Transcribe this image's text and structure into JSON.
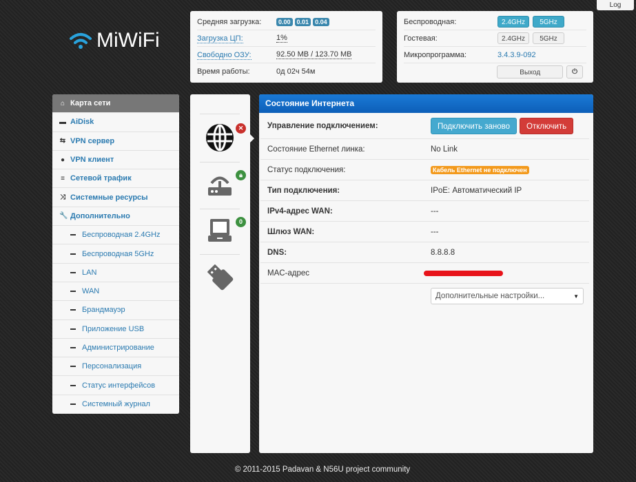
{
  "logo": "MiWiFi",
  "log_button": "Log",
  "status": {
    "avg_load_label": "Средняя загрузка:",
    "avg_load": [
      "0.00",
      "0.01",
      "0.04"
    ],
    "cpu_label": "Загрузка ЦП:",
    "cpu": "1%",
    "ram_label": "Свободно ОЗУ:",
    "ram": "92.50 MB / 123.70 MB",
    "uptime_label": "Время работы:",
    "uptime": "0д 02ч 54м"
  },
  "wireless": {
    "wireless_label": "Беспроводная:",
    "guest_label": "Гостевая:",
    "band24": "2.4GHz",
    "band5": "5GHz",
    "firmware_label": "Микропрограмма:",
    "firmware": "3.4.3.9-092",
    "logout": "Выход"
  },
  "sidebar": {
    "items": [
      {
        "label": "Карта сети",
        "icon": "home-icon",
        "glyph": "⌂"
      },
      {
        "label": "AiDisk",
        "icon": "hdd-icon",
        "glyph": "▬"
      },
      {
        "label": "VPN сервер",
        "icon": "retweet-icon",
        "glyph": "⇆"
      },
      {
        "label": "VPN клиент",
        "icon": "globe-icon",
        "glyph": "●"
      },
      {
        "label": "Сетевой трафик",
        "icon": "tasks-icon",
        "glyph": "≡"
      },
      {
        "label": "Системные ресурсы",
        "icon": "random-icon",
        "glyph": "⤨"
      },
      {
        "label": "Дополнительно",
        "icon": "wrench-icon",
        "glyph": "🔧"
      }
    ],
    "sub": [
      "Беспроводная 2.4GHz",
      "Беспроводная 5GHz",
      "LAN",
      "WAN",
      "Брандмауэр",
      "Приложение USB",
      "Администрирование",
      "Персонализация",
      "Статус интерфейсов",
      "Системный журнал"
    ]
  },
  "icons": {
    "clients_count": "0"
  },
  "main": {
    "title": "Состояние Интернета",
    "rows": [
      {
        "k": "Управление подключением:"
      },
      {
        "k": "Состояние Ethernet линка:",
        "v": "No Link"
      },
      {
        "k": "Статус подключения:",
        "v": "Кабель Ethernet не подключен"
      },
      {
        "k": "Тип подключения:",
        "v": "IPoE: Автоматический IP"
      },
      {
        "k": "IPv4-адрес WAN:",
        "v": "---"
      },
      {
        "k": "Шлюз WAN:",
        "v": "---"
      },
      {
        "k": "DNS:",
        "v": "8.8.8.8"
      },
      {
        "k": "MAC-адрес",
        "v": ""
      }
    ],
    "reconnect": "Подключить заново",
    "disconnect": "Отключить",
    "more_settings": "Дополнительные настройки..."
  },
  "footer": "© 2011-2015 Padavan & N56U project community"
}
